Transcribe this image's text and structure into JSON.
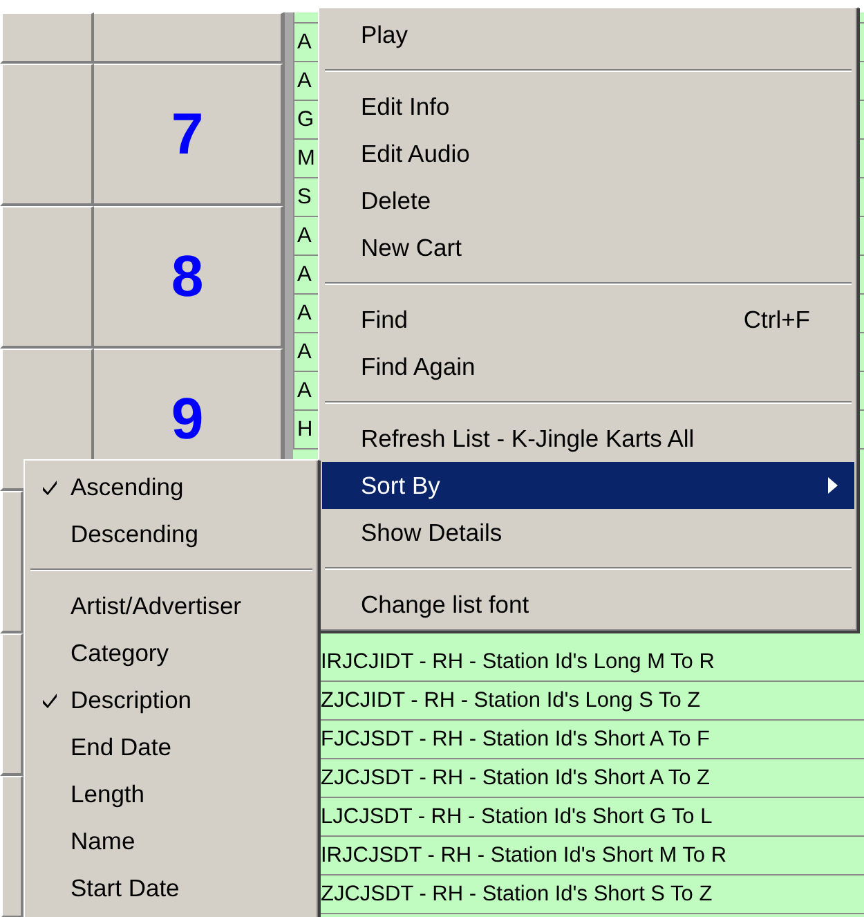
{
  "cart_grid": {
    "rows": [
      {
        "number": "7"
      },
      {
        "number": "8"
      },
      {
        "number": "9"
      }
    ]
  },
  "cart_list": {
    "rows_top": [
      {
        "text": "A"
      },
      {
        "text": "A"
      },
      {
        "text": "G"
      },
      {
        "text": "M"
      },
      {
        "text": "S"
      },
      {
        "text": "A"
      },
      {
        "text": "A"
      },
      {
        "text": "A"
      },
      {
        "text": "A"
      },
      {
        "text": "A"
      },
      {
        "text": "H"
      }
    ],
    "rows_bottom": [
      {
        "text": "IRJCJIDT - RH - Station Id's Long M To R"
      },
      {
        "text": "ZJCJIDT - RH - Station Id's Long S To Z"
      },
      {
        "text": "FJCJSDT - RH - Station Id's Short A To F"
      },
      {
        "text": "ZJCJSDT - RH - Station Id's Short A To Z"
      },
      {
        "text": "LJCJSDT - RH - Station Id's Short G To L"
      },
      {
        "text": "IRJCJSDT - RH - Station Id's Short M To R"
      },
      {
        "text": "ZJCJSDT - RH - Station Id's Short S To Z"
      }
    ]
  },
  "context_menu": {
    "items": [
      {
        "kind": "item",
        "label": "Play",
        "selected": false
      },
      {
        "kind": "separator"
      },
      {
        "kind": "item",
        "label": "Edit Info",
        "selected": false
      },
      {
        "kind": "item",
        "label": "Edit Audio",
        "selected": false
      },
      {
        "kind": "item",
        "label": "Delete",
        "selected": false
      },
      {
        "kind": "item",
        "label": "New Cart",
        "selected": false
      },
      {
        "kind": "separator"
      },
      {
        "kind": "item",
        "label": "Find",
        "shortcut": "Ctrl+F",
        "selected": false
      },
      {
        "kind": "item",
        "label": "Find Again",
        "selected": false
      },
      {
        "kind": "separator"
      },
      {
        "kind": "item",
        "label": "Refresh List - K-Jingle Karts All",
        "selected": false
      },
      {
        "kind": "submenu",
        "label": "Sort By",
        "selected": true
      },
      {
        "kind": "item",
        "label": "Show Details",
        "selected": false
      },
      {
        "kind": "separator"
      },
      {
        "kind": "item",
        "label": "Change list font",
        "selected": false
      }
    ]
  },
  "sort_submenu": {
    "items": [
      {
        "kind": "item",
        "label": "Ascending",
        "checked": true
      },
      {
        "kind": "item",
        "label": "Descending",
        "checked": false
      },
      {
        "kind": "separator"
      },
      {
        "kind": "item",
        "label": "Artist/Advertiser",
        "checked": false
      },
      {
        "kind": "item",
        "label": "Category",
        "checked": false
      },
      {
        "kind": "item",
        "label": "Description",
        "checked": true
      },
      {
        "kind": "item",
        "label": "End Date",
        "checked": false
      },
      {
        "kind": "item",
        "label": "Length",
        "checked": false
      },
      {
        "kind": "item",
        "label": "Name",
        "checked": false
      },
      {
        "kind": "item",
        "label": "Start Date",
        "checked": false
      }
    ]
  }
}
